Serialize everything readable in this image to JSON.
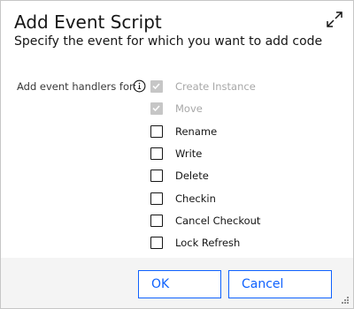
{
  "dialog": {
    "title": "Add Event Script",
    "subtitle": "Specify the event for which you want to add code",
    "expand_icon": "expand-icon"
  },
  "handlers": {
    "label": "Add event handlers for:",
    "info_icon": "info-icon",
    "events": [
      {
        "label": "Create Instance",
        "checked": true,
        "disabled": true
      },
      {
        "label": "Move",
        "checked": true,
        "disabled": true
      },
      {
        "label": "Rename",
        "checked": false,
        "disabled": false
      },
      {
        "label": "Write",
        "checked": false,
        "disabled": false
      },
      {
        "label": "Delete",
        "checked": false,
        "disabled": false
      },
      {
        "label": "Checkin",
        "checked": false,
        "disabled": false
      },
      {
        "label": "Cancel Checkout",
        "checked": false,
        "disabled": false
      },
      {
        "label": "Lock Refresh",
        "checked": false,
        "disabled": false
      }
    ]
  },
  "buttons": {
    "ok": "OK",
    "cancel": "Cancel"
  },
  "colors": {
    "accent": "#0f62fe",
    "footer": "#f4f4f4",
    "disabled": "#c6c6c6"
  }
}
